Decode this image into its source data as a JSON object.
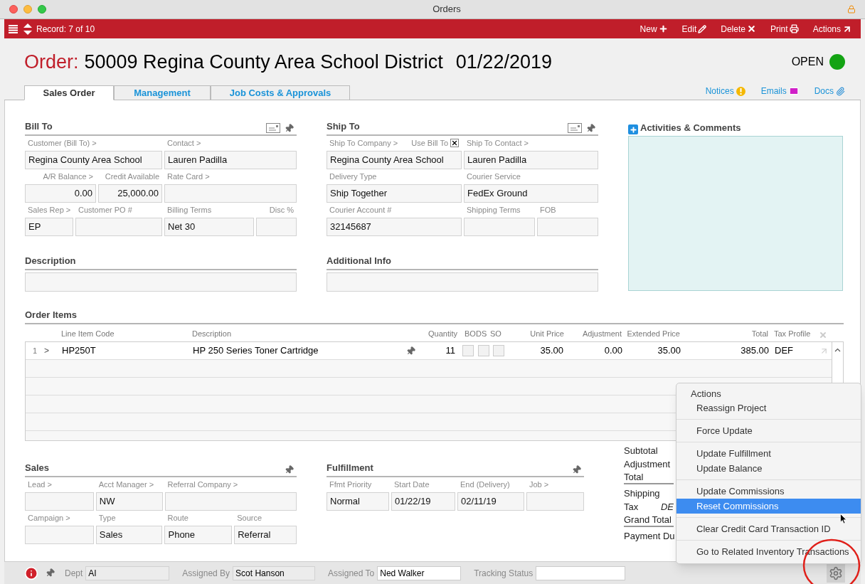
{
  "window": {
    "title": "Orders"
  },
  "toolbar": {
    "record": "Record: 7 of 10",
    "actions": [
      {
        "label": "New",
        "kind": "new"
      },
      {
        "label": "Edit",
        "kind": "edit"
      },
      {
        "label": "Delete",
        "kind": "delete"
      },
      {
        "label": "Print",
        "kind": "print"
      },
      {
        "label": "Actions",
        "kind": "actions"
      }
    ]
  },
  "header": {
    "label": "Order:",
    "title": "50009 Regina County Area School District",
    "date": "01/22/2019",
    "status": {
      "text": "OPEN",
      "color": "#13a313"
    }
  },
  "tabs": [
    {
      "label": "Sales Order",
      "selected": true
    },
    {
      "label": "Management",
      "selected": false
    },
    {
      "label": "Job Costs & Approvals",
      "selected": false
    }
  ],
  "links": [
    {
      "label": "Notices",
      "kind": "notices"
    },
    {
      "label": "Emails",
      "kind": "emails"
    },
    {
      "label": "Docs",
      "kind": "docs"
    }
  ],
  "bill_to": {
    "title": "Bill To",
    "rows": [
      {
        "left": [
          {
            "label": "Customer (Bill To) >",
            "value": "Regina County Area School"
          }
        ],
        "right": [
          {
            "label": "Contact >",
            "value": "Lauren Padilla"
          }
        ]
      },
      {
        "left": [
          {
            "label": "A/R Balance >",
            "value": "0.00"
          },
          {
            "label": "Credit Available",
            "value": "25,000.00"
          }
        ],
        "right": [
          {
            "label": "Rate Card >"
          }
        ]
      },
      {
        "left": [
          {
            "label": "Sales Rep >",
            "value": "EP"
          },
          {
            "label": "Customer PO #"
          }
        ],
        "right": [
          {
            "label": "Billing Terms",
            "value": "Net 30"
          },
          {
            "label": "Disc %"
          }
        ]
      }
    ]
  },
  "ship_to": {
    "title": "Ship To",
    "rows": [
      {
        "left": [
          {
            "label": "Ship To Company >",
            "value": "Regina County Area School",
            "option": {
              "label": "Use Bill To",
              "checked": true
            }
          }
        ],
        "right": [
          {
            "label": "Ship To Contact >",
            "value": "Lauren Padilla"
          }
        ]
      },
      {
        "left": [
          {
            "label": "Delivery Type",
            "value": "Ship Together"
          }
        ],
        "right": [
          {
            "label": "Courier Service",
            "value": "FedEx Ground"
          }
        ]
      },
      {
        "left": [
          {
            "label": "Courier Account #",
            "value": "32145687"
          }
        ],
        "right": [
          {
            "label": "Shipping Terms"
          },
          {
            "label": "FOB"
          }
        ]
      }
    ]
  },
  "activities": {
    "title": "Activities & Comments"
  },
  "description": {
    "title": "Description"
  },
  "additional_info": {
    "title": "Additional Info"
  },
  "order_items": {
    "title": "Order Items",
    "columns": [
      "Line Item Code",
      "Description",
      "Quantity",
      "BO",
      "DS",
      "SO",
      "Unit Price",
      "Adjustment",
      "Extended Price",
      "Total",
      "Tax Profile"
    ],
    "rows": [
      {
        "index": "1",
        "arrow": ">",
        "code": "HP250T",
        "description": "HP 250 Series Toner Cartridge",
        "quantity": "11",
        "bo": false,
        "ds": false,
        "so": false,
        "unit_price": "35.00",
        "adjustment": "0.00",
        "extended_price": "35.00",
        "total": "385.00",
        "tax_profile": "DEF"
      }
    ]
  },
  "sales": {
    "title": "Sales",
    "rows": [
      [
        {
          "label": "Lead >"
        },
        {
          "label": "Acct Manager >",
          "value": "NW"
        },
        {
          "label": "Referral Company >"
        }
      ],
      [
        {
          "label": "Campaign >"
        },
        {
          "label": "Type",
          "value": "Sales"
        },
        {
          "label": "Route",
          "value": "Phone"
        },
        {
          "label": "Source",
          "value": "Referral"
        }
      ]
    ]
  },
  "fulfillment": {
    "title": "Fulfillment",
    "rows": [
      [
        {
          "label": "Ffmt Priority",
          "value": "Normal"
        },
        {
          "label": "Start Date",
          "value": "01/22/19"
        },
        {
          "label": "End (Delivery)",
          "value": "02/11/19"
        },
        {
          "label": "Job >"
        }
      ]
    ]
  },
  "totals": [
    {
      "label": "Subtotal",
      "rule_after": false
    },
    {
      "label": "Adjustment",
      "rule_after": false
    },
    {
      "label": "Total",
      "rule_after": true
    },
    {
      "label": "Shipping",
      "rule_after": false
    },
    {
      "label": "Tax",
      "value": "DE",
      "rule_after": false
    },
    {
      "label": "Grand Total",
      "rule_after": true
    },
    {
      "label": "Payment Du",
      "rule_after": false
    }
  ],
  "status_bar": {
    "fields": [
      {
        "label": "Dept",
        "value": "AI",
        "editable": false
      },
      {
        "label": "Assigned By",
        "value": "Scot Hanson",
        "editable": false
      },
      {
        "label": "Assigned To",
        "value": "Ned Walker",
        "editable": true
      },
      {
        "label": "Tracking Status",
        "editable": true
      }
    ]
  },
  "actions_menu": {
    "title": "Actions",
    "groups": [
      [
        {
          "label": "Reassign Project",
          "selected": false
        }
      ],
      [
        {
          "label": "Force Update",
          "selected": false
        }
      ],
      [
        {
          "label": "Update Fulfillment",
          "selected": false
        },
        {
          "label": "Update Balance",
          "selected": false
        }
      ],
      [
        {
          "label": "Update Commissions",
          "selected": false
        },
        {
          "label": "Reset Commissions",
          "selected": true
        }
      ],
      [
        {
          "label": "Clear Credit Card Transaction ID",
          "selected": false
        }
      ],
      [
        {
          "label": "Go to Related Inventory Transactions",
          "selected": false
        }
      ]
    ]
  }
}
